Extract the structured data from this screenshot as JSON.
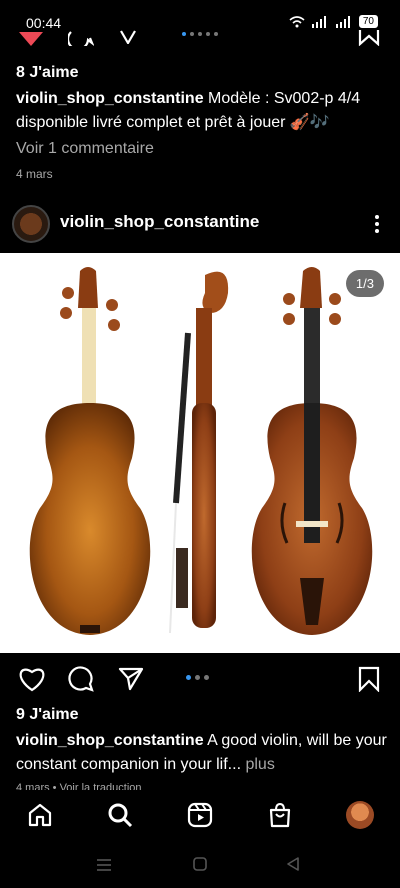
{
  "status_bar": {
    "time": "00:44",
    "battery": "70"
  },
  "previous_post": {
    "likes": "8 J'aime",
    "username": "violin_shop_constantine",
    "caption": " Modèle : Sv002-p 4/4 disponible livré complet et prêt à jouer 🎻🎶",
    "comments_link": "Voir 1 commentaire",
    "date": "4 mars"
  },
  "post": {
    "username": "violin_shop_constantine",
    "image_counter": "1/3",
    "likes": "9 J'aime",
    "caption_user": "violin_shop_constantine",
    "caption_text": " A good violin, will be your constant companion in your lif...",
    "more_link": " plus",
    "meta": "4 mars • Voir la traduction"
  },
  "icons": {
    "like": "heart-icon",
    "comment": "comment-icon",
    "share": "send-icon",
    "save": "bookmark-icon",
    "home": "home-icon",
    "search": "search-icon",
    "reels": "reels-icon",
    "shop": "shop-icon"
  },
  "colors": {
    "background": "#000000",
    "accent": "#3897f0",
    "muted": "#a8a8a8"
  }
}
